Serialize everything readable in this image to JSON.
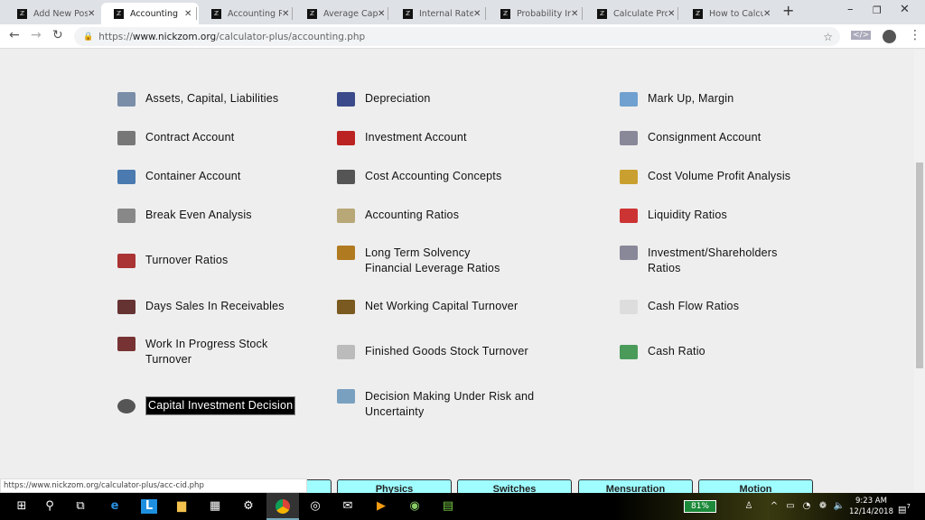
{
  "browser": {
    "tabs": [
      {
        "label": "Add New Post",
        "active": false
      },
      {
        "label": "Accounting",
        "active": true
      },
      {
        "label": "Accounting Ra",
        "active": false
      },
      {
        "label": "Average Capit",
        "active": false
      },
      {
        "label": "Internal Rate o",
        "active": false
      },
      {
        "label": "Probability Ind",
        "active": false
      },
      {
        "label": "Calculate Prob",
        "active": false
      },
      {
        "label": "How to Calcula",
        "active": false
      }
    ],
    "url_prefix": "https://",
    "url_domain": "www.nickzom.org",
    "url_path": "/calculator-plus/accounting.php",
    "status_url": "https://www.nickzom.org/calculator-plus/acc-cid.php"
  },
  "topics": [
    [
      "Assets, Capital, Liabilities",
      "Depreciation",
      "Mark Up, Margin"
    ],
    [
      "Contract Account",
      "Investment Account",
      "Consignment Account"
    ],
    [
      "Container Account",
      "Cost Accounting Concepts",
      "Cost Volume Profit Analysis"
    ],
    [
      "Break Even Analysis",
      "Accounting Ratios",
      "Liquidity Ratios"
    ],
    [
      "Turnover Ratios",
      "Long Term Solvency\nFinancial Leverage Ratios",
      "Investment/Shareholders\nRatios"
    ],
    [
      "Days Sales In Receivables",
      "Net Working Capital Turnover",
      "Cash Flow Ratios"
    ],
    [
      "Work In Progress Stock\nTurnover",
      "Finished Goods Stock Turnover",
      "Cash Ratio"
    ],
    [
      "Capital Investment Decision",
      "Decision Making Under Risk and\nUncertainty",
      ""
    ]
  ],
  "selected_topic": "Capital Investment Decision",
  "bottom_nav": [
    "",
    "Physics",
    "Switches",
    "Mensuration",
    "Motion"
  ],
  "taskbar": {
    "battery": "81%",
    "time": "9:23 AM",
    "date": "12/14/2018",
    "notifications": "7"
  }
}
